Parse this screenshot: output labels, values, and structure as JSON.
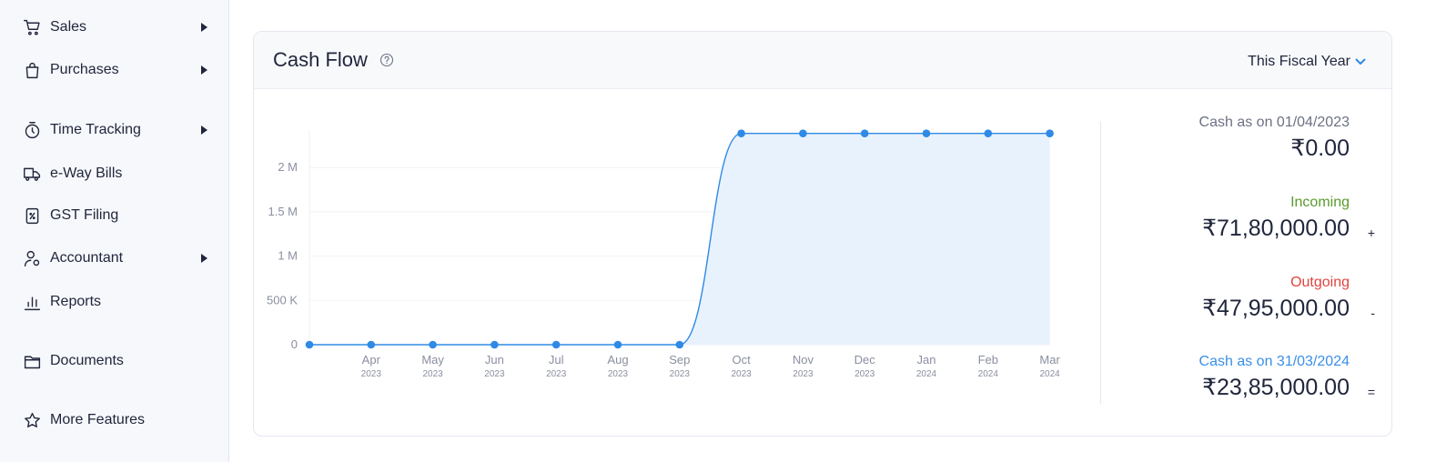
{
  "sidebar": {
    "items": [
      {
        "label": "Sales",
        "icon": "cart-icon",
        "has_submenu": true
      },
      {
        "label": "Purchases",
        "icon": "shopping-bag-icon",
        "has_submenu": true
      },
      {
        "label": "Time Tracking",
        "icon": "stopwatch-icon",
        "has_submenu": true
      },
      {
        "label": "e-Way Bills",
        "icon": "truck-icon",
        "has_submenu": false
      },
      {
        "label": "GST Filing",
        "icon": "tax-document-icon",
        "has_submenu": false
      },
      {
        "label": "Accountant",
        "icon": "accountant-icon",
        "has_submenu": true
      },
      {
        "label": "Reports",
        "icon": "bar-chart-icon",
        "has_submenu": false
      },
      {
        "label": "Documents",
        "icon": "folder-icon",
        "has_submenu": false
      },
      {
        "label": "More Features",
        "icon": "star-icon",
        "has_submenu": false
      }
    ]
  },
  "card": {
    "title": "Cash Flow",
    "period": "This Fiscal Year",
    "colors": {
      "accent": "#2f8ae6",
      "incoming": "#5a9a2c",
      "outgoing": "#e0443f",
      "closing": "#3a8fe8",
      "muted": "#6c7184"
    }
  },
  "summary": {
    "opening_label": "Cash as on 01/04/2023",
    "opening_value": "₹0.00",
    "incoming_label": "Incoming",
    "incoming_value": "₹71,80,000.00",
    "incoming_op": "+",
    "outgoing_label": "Outgoing",
    "outgoing_value": "₹47,95,000.00",
    "outgoing_op": "-",
    "closing_label": "Cash as on 31/03/2024",
    "closing_value": "₹23,85,000.00",
    "closing_op": "="
  },
  "chart_data": {
    "type": "area",
    "y_ticks": [
      "0",
      "500 K",
      "1 M",
      "1.5 M",
      "2 M"
    ],
    "y_tick_values": [
      0,
      500000,
      1000000,
      1500000,
      2000000
    ],
    "ylim": [
      0,
      2500000
    ],
    "x_labels": [
      {
        "month": "",
        "year": ""
      },
      {
        "month": "Apr",
        "year": "2023"
      },
      {
        "month": "May",
        "year": "2023"
      },
      {
        "month": "Jun",
        "year": "2023"
      },
      {
        "month": "Jul",
        "year": "2023"
      },
      {
        "month": "Aug",
        "year": "2023"
      },
      {
        "month": "Sep",
        "year": "2023"
      },
      {
        "month": "Oct",
        "year": "2023"
      },
      {
        "month": "Nov",
        "year": "2023"
      },
      {
        "month": "Dec",
        "year": "2023"
      },
      {
        "month": "Jan",
        "year": "2024"
      },
      {
        "month": "Feb",
        "year": "2024"
      },
      {
        "month": "Mar",
        "year": "2024"
      }
    ],
    "values": [
      0,
      0,
      0,
      0,
      0,
      0,
      0,
      2385000,
      2385000,
      2385000,
      2385000,
      2385000,
      2385000
    ],
    "grid": true,
    "legend": "none"
  }
}
